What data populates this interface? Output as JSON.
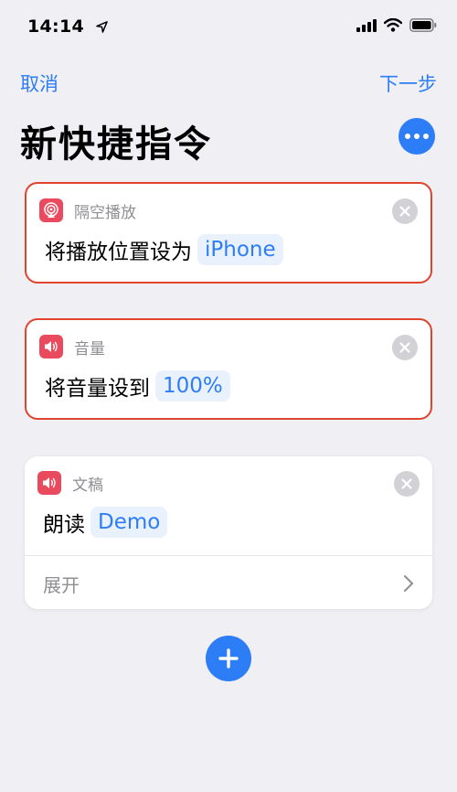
{
  "status": {
    "time": "14:14"
  },
  "nav": {
    "cancel": "取消",
    "next": "下一步"
  },
  "title": "新快捷指令",
  "cards": [
    {
      "app": "隔空播放",
      "icon": "airplay-icon",
      "text": "将播放位置设为",
      "token": "iPhone"
    },
    {
      "app": "音量",
      "icon": "speaker-icon",
      "text": "将音量设到",
      "token": "100%"
    },
    {
      "app": "文稿",
      "icon": "speaker-icon",
      "text": "朗读",
      "token": "Demo",
      "expand": "展开"
    }
  ],
  "colors": {
    "accent": "#2d7df6",
    "selection": "#e0432e",
    "app_icon": "#ea4a5e"
  }
}
